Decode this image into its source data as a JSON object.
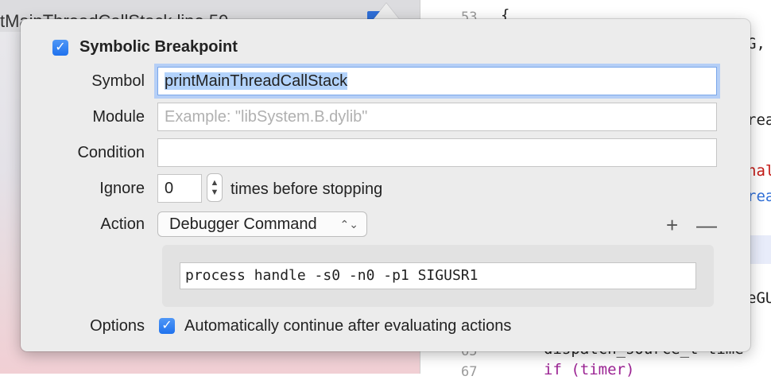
{
  "background": {
    "navigator_row_text": "tMainThreadCallStack line 59",
    "editor": {
      "gutter": [
        "53",
        "65",
        "67"
      ],
      "fragments": [
        "{",
        "G,",
        "rea",
        "nal",
        "rea",
        "eGU",
        "dispatch_source_t time",
        "if (timer)"
      ]
    }
  },
  "dialog": {
    "title": "Symbolic Breakpoint",
    "enabled": true,
    "symbol": {
      "label": "Symbol",
      "value": "printMainThreadCallStack"
    },
    "module": {
      "label": "Module",
      "placeholder": "Example: \"libSystem.B.dylib\""
    },
    "condition": {
      "label": "Condition",
      "value": ""
    },
    "ignore": {
      "label": "Ignore",
      "value": "0",
      "suffix": "times before stopping"
    },
    "action": {
      "label": "Action",
      "selected": "Debugger Command",
      "add_symbol": "+",
      "remove_symbol": "—",
      "command": "process handle -s0 -n0 -p1 SIGUSR1"
    },
    "options": {
      "label": "Options",
      "auto_continue_checked": true,
      "auto_continue_label": "Automatically continue after evaluating actions"
    }
  },
  "colors": {
    "accent": "#1f72ee",
    "popover_bg": "#ececec",
    "focus_ring": "#b5cff6"
  }
}
